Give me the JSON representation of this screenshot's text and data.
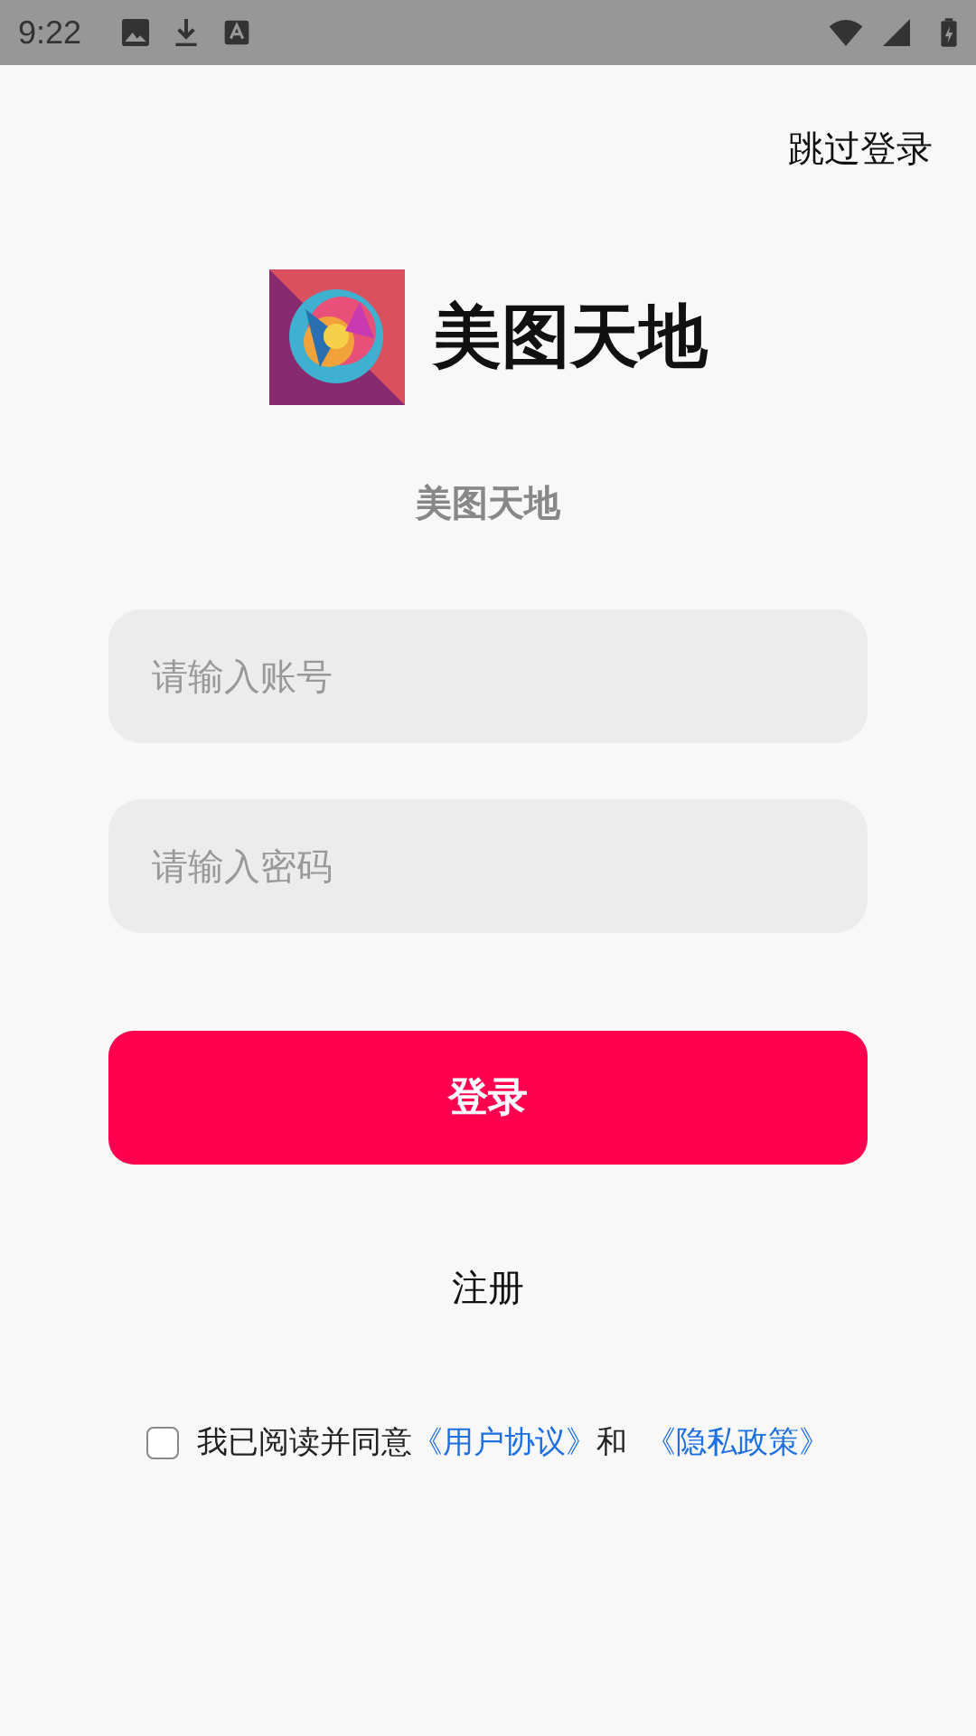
{
  "status_bar": {
    "time": "9:22"
  },
  "skip_link": "跳过登录",
  "brand": {
    "name": "美图天地"
  },
  "subtitle": "美图天地",
  "fields": [
    {
      "placeholder": "请输入账号"
    },
    {
      "placeholder": "请输入密码"
    }
  ],
  "login_button": "登录",
  "register_link": "注册",
  "agreement": {
    "checked": false,
    "text": "我已阅读并同意",
    "links": [
      "《用户协议》",
      "《隐私政策》"
    ],
    "joiner": "和"
  }
}
